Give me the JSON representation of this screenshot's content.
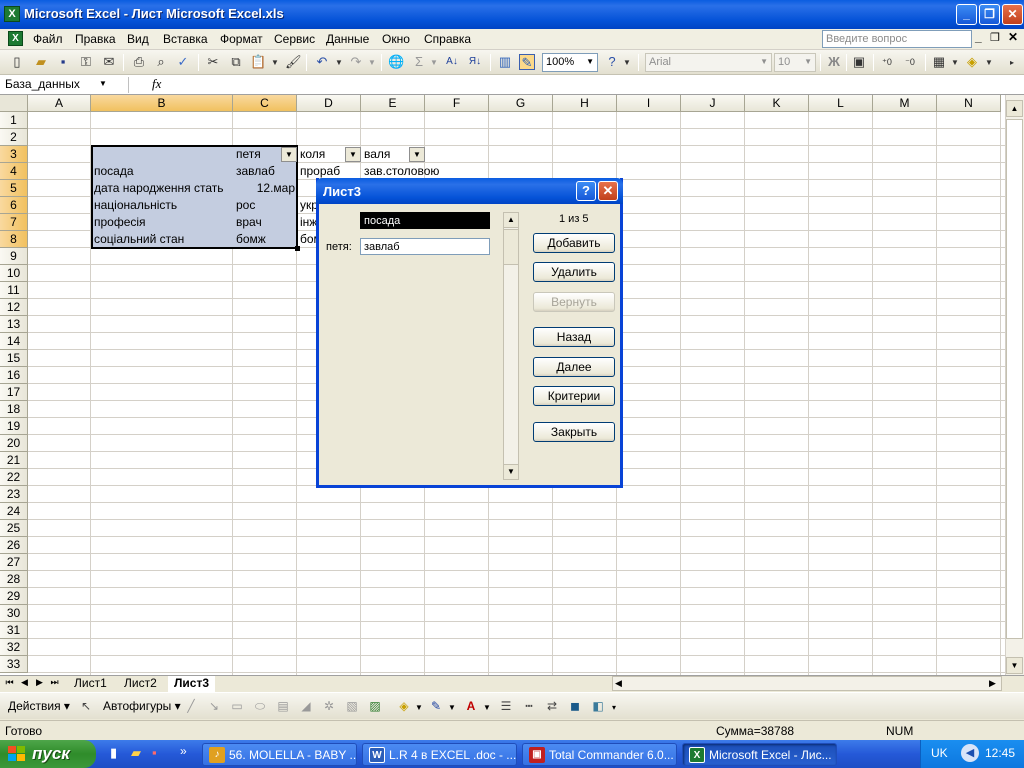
{
  "window": {
    "title": "Microsoft Excel - Лист Microsoft Excel.xls",
    "app_icon": "excel-icon"
  },
  "menu": {
    "items": [
      "Файл",
      "Правка",
      "Вид",
      "Вставка",
      "Формат",
      "Сервис",
      "Данные",
      "Окно",
      "Справка"
    ],
    "ask_placeholder": "Введите вопрос"
  },
  "toolbar": {
    "zoom": "100%",
    "font": "Arial",
    "size": "10",
    "bold": "Ж",
    "sigma": "Σ"
  },
  "formula_bar": {
    "name_box": "База_данных",
    "fx": "fx"
  },
  "grid": {
    "columns": [
      "A",
      "B",
      "C",
      "D",
      "E",
      "F",
      "G",
      "H",
      "I",
      "J",
      "K",
      "L",
      "M",
      "N"
    ],
    "selected_columns": [
      "B",
      "C"
    ],
    "rows": [
      "1",
      "2",
      "3",
      "4",
      "5",
      "6",
      "7",
      "8",
      "9",
      "10",
      "11",
      "12",
      "13",
      "14",
      "15",
      "16",
      "17",
      "18",
      "19",
      "20",
      "21",
      "22",
      "23",
      "24",
      "25",
      "26",
      "27",
      "28",
      "29",
      "30",
      "31",
      "32",
      "33"
    ],
    "selected_rows": [
      "3",
      "4",
      "5",
      "6",
      "7",
      "8"
    ],
    "cells": {
      "C3": "петя",
      "D3": "коля",
      "E3": "валя",
      "B4": "посада",
      "C4": "завлаб",
      "D4": "прораб",
      "E4": "зав.столовою",
      "B5": "дата народження стать",
      "C5": "12.мар",
      "B6": "національність",
      "C6": "рос",
      "D6": "укр",
      "B7": "професія",
      "C7": "врач",
      "D7": "інж",
      "B8": "соціальний стан",
      "C8": "бомж",
      "D8": "бом"
    }
  },
  "sheet_tabs": [
    "Лист1",
    "Лист2",
    "Лист3"
  ],
  "active_sheet": "Лист3",
  "drawing_toolbar": {
    "actions": "Действия",
    "autoshapes": "Автофигуры"
  },
  "status": {
    "ready": "Готово",
    "sum": "Сумма=38788",
    "num": "NUM"
  },
  "dialog": {
    "title": "Лист3",
    "record_counter": "1 из 5",
    "field1_value": "посада",
    "field2_label": "петя:",
    "field2_value": "завлаб",
    "buttons": {
      "add": "Добавить",
      "delete": "Удалить",
      "restore": "Вернуть",
      "back": "Назад",
      "next": "Далее",
      "criteria": "Критерии",
      "close": "Закрыть"
    }
  },
  "taskbar": {
    "start": "пуск",
    "tasks": [
      "56. MOLELLA - BABY ...",
      "L.R 4 в EXCEL .doc - ...",
      "Total Commander 6.0...",
      "Microsoft Excel - Лис..."
    ],
    "lang": "UK",
    "clock": "12:45"
  },
  "colors": {
    "title_blue": "#0553d8",
    "selection": "#c4cde0",
    "header_selected": "#f1c15f",
    "start_green": "#2f8c2a"
  }
}
